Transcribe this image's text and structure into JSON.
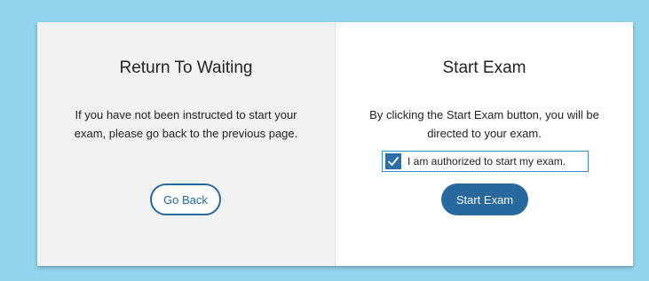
{
  "colors": {
    "page_background": "#93d3ec",
    "left_panel_background": "#f1f2f4",
    "accent": "#27699f",
    "checkbox_border": "#3a8fc9"
  },
  "return_panel": {
    "title": "Return To Waiting",
    "description_line1": "If you have not been instructed to start your",
    "description_line2": "exam, please go back to the previous page.",
    "go_back_label": "Go Back"
  },
  "start_panel": {
    "title": "Start Exam",
    "description_line1": "By clicking the Start Exam button, you will be",
    "description_line2": "directed to your exam.",
    "authorize_label": "I am authorized to start my exam.",
    "authorize_checked": true,
    "checkbox_icon": "check-icon",
    "start_label": "Start Exam"
  }
}
